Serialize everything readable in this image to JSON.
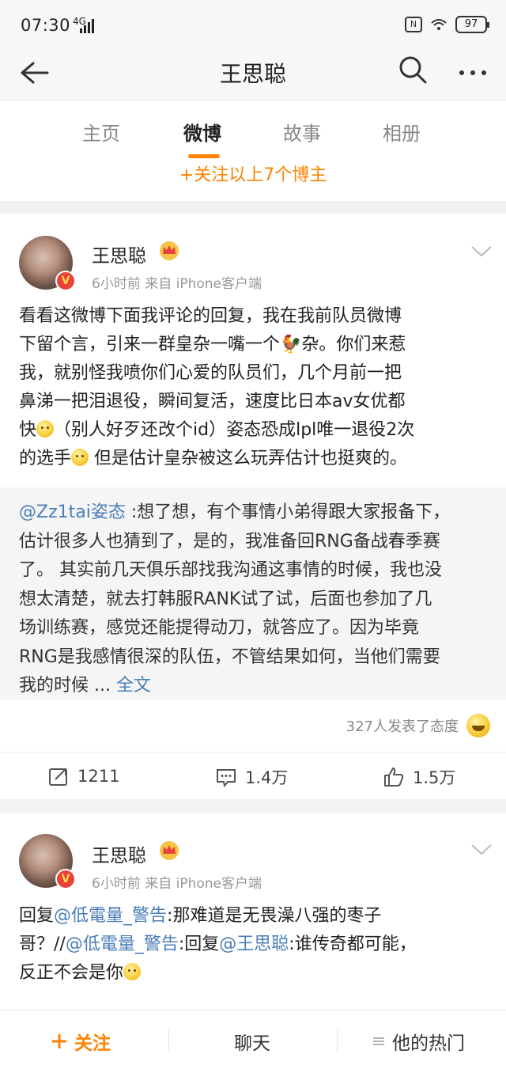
{
  "status_bar": {
    "time": "07:30",
    "signal": "4G",
    "battery": "97"
  },
  "nav": {
    "title": "王思聪"
  },
  "tabs": [
    {
      "label": "主页"
    },
    {
      "label": "微博"
    },
    {
      "label": "故事"
    },
    {
      "label": "相册"
    }
  ],
  "follow_more": "+关注以上7个博主",
  "post1": {
    "user": "王思聪",
    "meta": "6小时前  来自 iPhone客户端",
    "text_lines": [
      "看看这微博下面我评论的回复，我在我前队员微博",
      "下留个言，引来一群皇杂一嘴一个🐓杂。你们来惹",
      "我，就别怪我喷你们心爱的队员们，几个月前一把",
      "鼻涕一把泪退役，瞬间复活，速度比日本av女优都",
      "快",
      "（别人好歹还改个id）姿态恐成lpl唯一退役2次",
      "的选手",
      " 但是估计皇杂被这么玩弄估计也挺爽的。"
    ],
    "retweet": {
      "mention": "@Zz1tai姿态",
      "lines": [
        " :想了想，有个事情小弟得跟大家报备下，",
        "估计很多人也猜到了，是的，我准备回RNG备战春季赛",
        "了。 其实前几天俱乐部找我沟通这事情的时候，我也没",
        "想太清楚，就去打韩服RANK试了试，后面也参加了几",
        "场训练赛，感觉还能提得动刀，就答应了。因为毕竟",
        "RNG是我感情很深的队伍，不管结果如何，当他们需要",
        "我的时候 ... "
      ],
      "full_text_link": "全文"
    },
    "reactions": "327人发表了态度",
    "repost_count": "1211",
    "comment_count": "1.4万",
    "like_count": "1.5万"
  },
  "post2": {
    "user": "王思聪",
    "meta": "6小时前  来自 iPhone客户端",
    "line1_prefix": "回复",
    "line1_mention": "@低電量_警告",
    "line1_rest": ":那难道是无畏澡八强的枣子",
    "line2_prefix": "哥？//",
    "line2_mention1": "@低電量_警告",
    "line2_mid": ":回复",
    "line2_mention2": "@王思聪",
    "line2_rest": ":谁传奇都可能，",
    "line3": "反正不会是你"
  },
  "bottom_bar": {
    "follow": "关注",
    "chat": "聊天",
    "hot": "他的热门"
  },
  "colors": {
    "accent": "#ff8200",
    "link": "#4a7eb8",
    "verified": "#e8423a"
  },
  "icons": {
    "back": "arrow-left-icon",
    "search": "search-icon",
    "more": "more-dots-icon",
    "repost": "share-icon",
    "comment": "comment-icon",
    "like": "thumb-up-icon"
  }
}
